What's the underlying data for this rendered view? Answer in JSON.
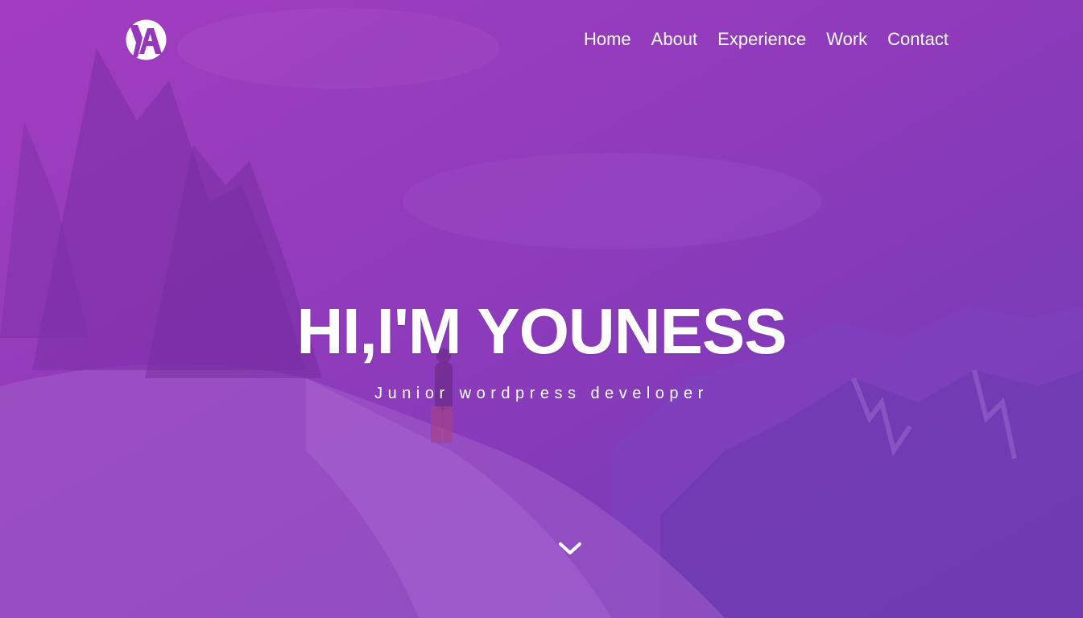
{
  "header": {
    "logo_icon": "ya-monogram-logo",
    "nav": [
      {
        "label": "Home"
      },
      {
        "label": "About"
      },
      {
        "label": "Experience"
      },
      {
        "label": "Work"
      },
      {
        "label": "Contact"
      }
    ]
  },
  "hero": {
    "headline": "HI,I'M YOUNESS",
    "subtitle": "Junior wordpress developer",
    "scroll_icon": "chevron-down-icon",
    "overlay_color": "#8a3ab9"
  }
}
